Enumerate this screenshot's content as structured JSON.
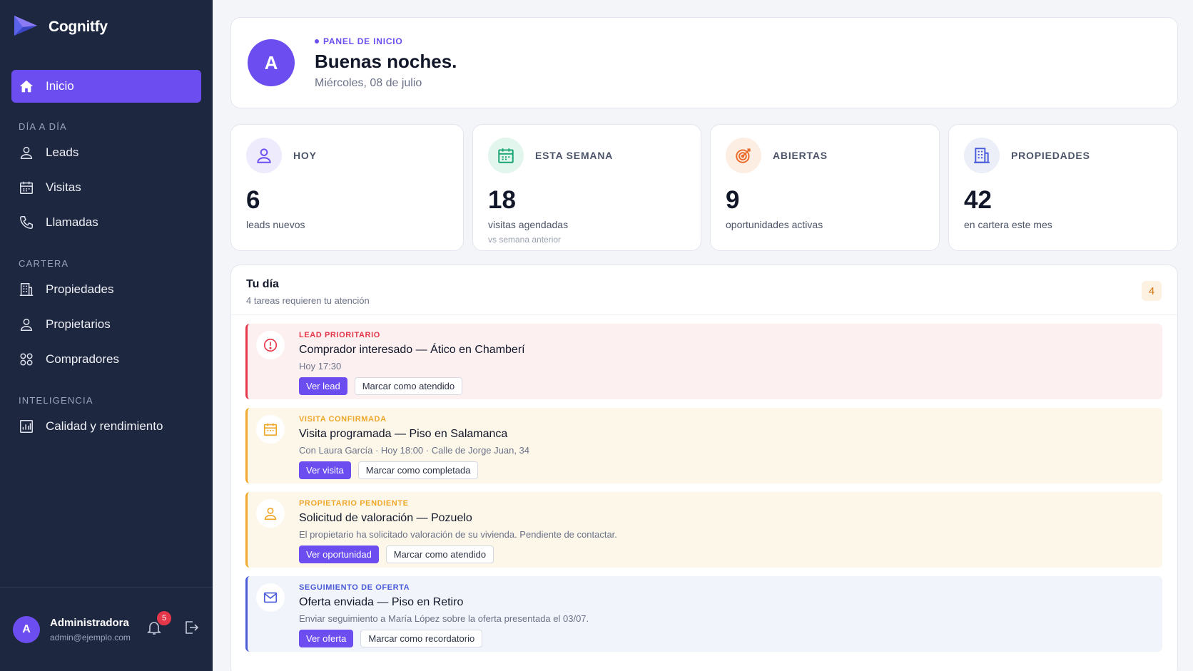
{
  "brand": {
    "name": "Cognitfy"
  },
  "sidebar": {
    "active": {
      "label": "Inicio",
      "icon": "home-icon"
    },
    "sections": [
      {
        "title": "DÍA A DÍA",
        "items": [
          {
            "label": "Leads",
            "icon": "user-icon"
          },
          {
            "label": "Visitas",
            "icon": "calendar-icon"
          },
          {
            "label": "Llamadas",
            "icon": "phone-icon"
          }
        ]
      },
      {
        "title": "CARTERA",
        "items": [
          {
            "label": "Propiedades",
            "icon": "building-icon"
          },
          {
            "label": "Propietarios",
            "icon": "user-icon"
          },
          {
            "label": "Compradores",
            "icon": "users-icon"
          }
        ]
      },
      {
        "title": "INTELIGENCIA",
        "items": [
          {
            "label": "Calidad y rendimiento",
            "icon": "chart-icon"
          }
        ]
      }
    ],
    "user": {
      "initial": "A",
      "name": "Administradora",
      "email": "admin@ejemplo.com",
      "notifications": "5"
    }
  },
  "hero": {
    "initial": "A",
    "eyebrow": "PANEL DE INICIO",
    "greeting": "Buenas noches.",
    "date": "Miércoles, 08 de julio"
  },
  "stats": [
    {
      "label": "HOY",
      "value": "6",
      "desc": "leads nuevos",
      "sub": "",
      "icon": "user-icon",
      "color": "#6b4df0",
      "bg": "#eeebfd"
    },
    {
      "label": "ESTA SEMANA",
      "value": "18",
      "desc": "visitas agendadas",
      "sub": "vs semana anterior",
      "icon": "calendar-icon",
      "color": "#18a572",
      "bg": "#e2f6ee"
    },
    {
      "label": "ABIERTAS",
      "value": "9",
      "desc": "oportunidades activas",
      "sub": "",
      "icon": "target-icon",
      "color": "#ea6a2a",
      "bg": "#fdeee4"
    },
    {
      "label": "PROPIEDADES",
      "value": "42",
      "desc": "en cartera este mes",
      "sub": "",
      "icon": "building-icon",
      "color": "#4a5bd9",
      "bg": "#eceef8"
    }
  ],
  "tasks": {
    "title": "Tu día",
    "subtitle": "4 tareas requieren tu atención",
    "count": "4",
    "items": [
      {
        "tag": "LEAD PRIORITARIO",
        "title": "Comprador interesado — Ático en Chamberí",
        "meta": "Hoy 17:30",
        "primary": "Ver lead",
        "secondary": "Marcar como atendido",
        "icon": "alert-icon",
        "accent": "#e5374a",
        "bg": "#fdf0f1"
      },
      {
        "tag": "VISITA CONFIRMADA",
        "title": "Visita programada — Piso en Salamanca",
        "meta": "Con Laura García · Hoy 18:00 · Calle de Jorge Juan, 34",
        "primary": "Ver visita",
        "secondary": "Marcar como completada",
        "icon": "calendar-icon",
        "accent": "#efa72a",
        "bg": "#fdf7ea"
      },
      {
        "tag": "PROPIETARIO PENDIENTE",
        "title": "Solicitud de valoración — Pozuelo",
        "meta": "El propietario ha solicitado valoración de su vivienda. Pendiente de contactar.",
        "primary": "Ver oportunidad",
        "secondary": "Marcar como atendido",
        "icon": "user-icon",
        "accent": "#efa72a",
        "bg": "#fdf7ea"
      },
      {
        "tag": "SEGUIMIENTO DE OFERTA",
        "title": "Oferta enviada — Piso en Retiro",
        "meta": "Enviar seguimiento a María López sobre la oferta presentada el 03/07.",
        "primary": "Ver oferta",
        "secondary": "Marcar como recordatorio",
        "icon": "mail-icon",
        "accent": "#4a5bd9",
        "bg": "#f2f4fb"
      }
    ]
  }
}
